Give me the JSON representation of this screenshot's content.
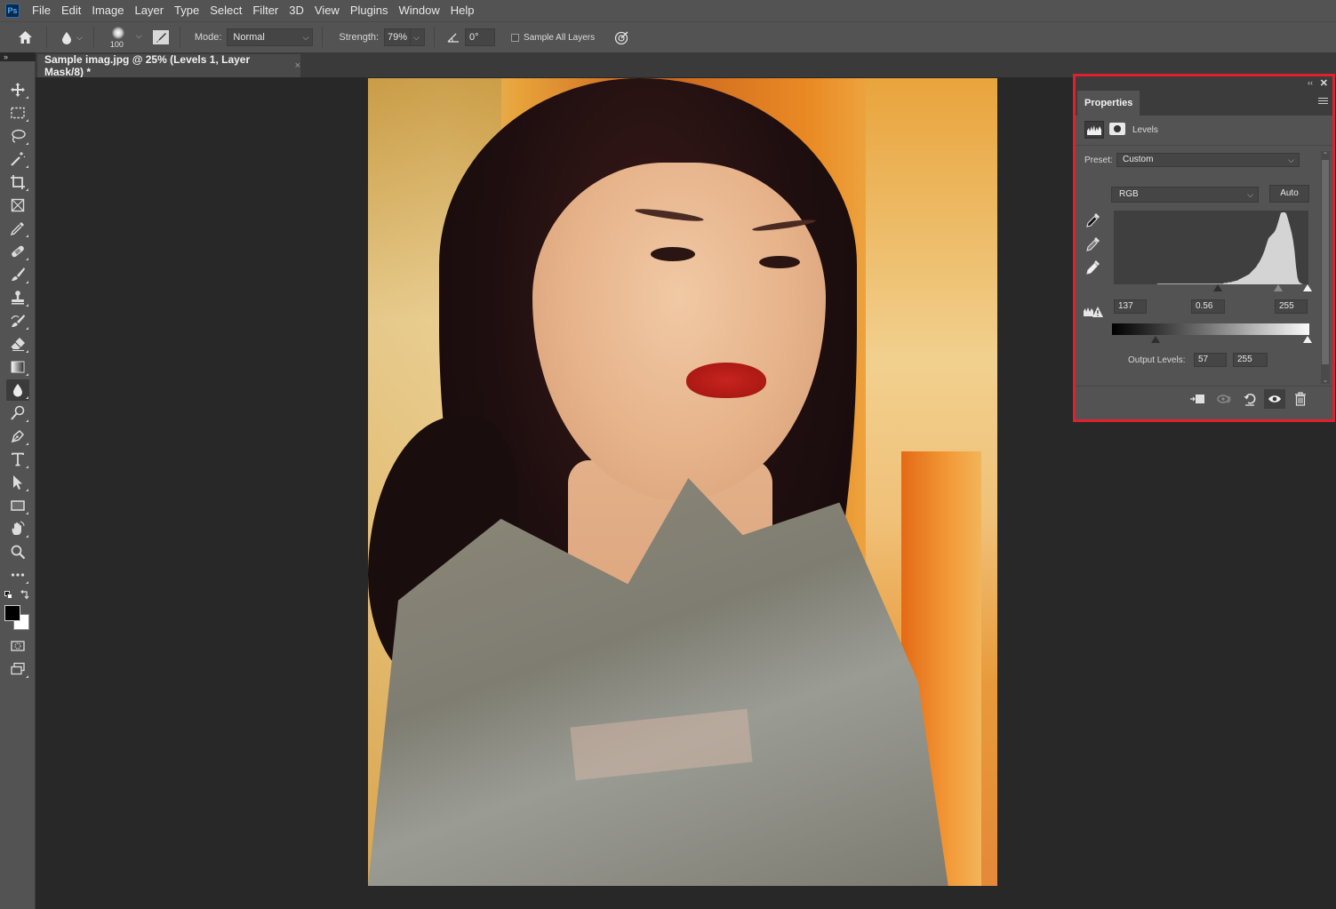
{
  "app": {
    "logo": "Ps",
    "name": "Adobe Photoshop"
  },
  "menu": [
    "File",
    "Edit",
    "Image",
    "Layer",
    "Type",
    "Select",
    "Filter",
    "3D",
    "View",
    "Plugins",
    "Window",
    "Help"
  ],
  "options_bar": {
    "home_icon": "home-icon",
    "tool_preset_icon": "blur-drop-icon",
    "brush_size": "100",
    "brush_settings_icon": "brush-settings-icon",
    "mode_label": "Mode:",
    "mode_value": "Normal",
    "strength_label": "Strength:",
    "strength_value": "79%",
    "angle_icon": "angle-icon",
    "angle_value": "0°",
    "sample_all_layers_label": "Sample All Layers",
    "sample_all_layers_checked": false,
    "pressure_icon": "pressure-strength-icon"
  },
  "toolbar": {
    "collapse_icon": "»",
    "tools": [
      {
        "name": "move-tool",
        "icon": "move-icon"
      },
      {
        "name": "marquee-tool",
        "icon": "rectangle-marquee-icon"
      },
      {
        "name": "lasso-tool",
        "icon": "lasso-icon"
      },
      {
        "name": "magic-wand-tool",
        "icon": "magic-wand-icon"
      },
      {
        "name": "crop-tool",
        "icon": "crop-icon"
      },
      {
        "name": "frame-tool",
        "icon": "frame-icon"
      },
      {
        "name": "eyedropper-tool",
        "icon": "eyedropper-icon"
      },
      {
        "name": "healing-brush-tool",
        "icon": "bandage-icon"
      },
      {
        "name": "brush-tool",
        "icon": "brush-icon"
      },
      {
        "name": "clone-stamp-tool",
        "icon": "stamp-icon"
      },
      {
        "name": "history-brush-tool",
        "icon": "history-brush-icon"
      },
      {
        "name": "eraser-tool",
        "icon": "eraser-icon"
      },
      {
        "name": "gradient-tool",
        "icon": "gradient-icon"
      },
      {
        "name": "blur-tool",
        "icon": "blur-drop-icon",
        "active": true
      },
      {
        "name": "dodge-tool",
        "icon": "dodge-icon"
      },
      {
        "name": "pen-tool",
        "icon": "pen-icon"
      },
      {
        "name": "type-tool",
        "icon": "type-icon"
      },
      {
        "name": "path-selection-tool",
        "icon": "arrow-icon"
      },
      {
        "name": "rectangle-tool",
        "icon": "rectangle-icon"
      },
      {
        "name": "hand-tool",
        "icon": "hand-icon"
      },
      {
        "name": "zoom-tool",
        "icon": "zoom-icon"
      },
      {
        "name": "more-tools",
        "icon": "ellipsis-icon"
      }
    ],
    "foreground_color": "#000000",
    "background_color": "#ffffff"
  },
  "document": {
    "tab_title": "Sample imag.jpg @ 25% (Levels 1, Layer Mask/8) *",
    "close_icon": "×"
  },
  "properties_panel": {
    "tab_label": "Properties",
    "adjustment_title": "Levels",
    "preset_label": "Preset:",
    "preset_value": "Custom",
    "channel_value": "RGB",
    "auto_label": "Auto",
    "input_black": "137",
    "input_gamma": "0.56",
    "input_white": "255",
    "output_label": "Output Levels:",
    "output_black": "57",
    "output_white": "255",
    "highlight_color": "#e0202e",
    "histogram": [
      0,
      0,
      0,
      0,
      0,
      0,
      0,
      0,
      0,
      0,
      0,
      0,
      0,
      0,
      0,
      0,
      0,
      0,
      0,
      0,
      0,
      0,
      0,
      0,
      0,
      0,
      0,
      0,
      0,
      0,
      0,
      0,
      1,
      1,
      1,
      1,
      1,
      1,
      1,
      1,
      1,
      1,
      1,
      1,
      1,
      1,
      1,
      1,
      1,
      1,
      1,
      1,
      1,
      1,
      1,
      1,
      1,
      1,
      1,
      1,
      1,
      1,
      1,
      1,
      1,
      1,
      1,
      1,
      1,
      1,
      1,
      1,
      1,
      1,
      1,
      1,
      1,
      1,
      1,
      1,
      2,
      2,
      2,
      3,
      3,
      3,
      4,
      4,
      5,
      5,
      6,
      7,
      8,
      9,
      10,
      11,
      12,
      13,
      14,
      16,
      18,
      20,
      22,
      24,
      27,
      30,
      33,
      37,
      41,
      46,
      52,
      58,
      64,
      66,
      68,
      70,
      72,
      75,
      80,
      86,
      93,
      99,
      100,
      100,
      100,
      98,
      92,
      85,
      78,
      70,
      60,
      45,
      25,
      10,
      4,
      2,
      1,
      0,
      0,
      0,
      0,
      0
    ]
  }
}
